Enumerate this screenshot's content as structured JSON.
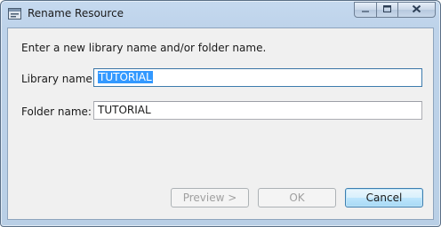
{
  "window": {
    "title": "Rename Resource",
    "icon": "folder-rename-icon"
  },
  "caption_buttons": {
    "minimize_icon": "minimize-icon",
    "maximize_icon": "maximize-icon",
    "close_icon": "close-icon"
  },
  "dialog": {
    "prompt": "Enter a new library name and/or folder name.",
    "library_label": "Library name:",
    "library_value": "TUTORIAL",
    "folder_label": "Folder name:",
    "folder_value": "TUTORIAL"
  },
  "buttons": {
    "preview": "Preview >",
    "ok": "OK",
    "cancel": "Cancel"
  },
  "colors": {
    "selection": "#3399ff",
    "frame": "#c5d9ef",
    "client_background": "#f0f0f0"
  }
}
